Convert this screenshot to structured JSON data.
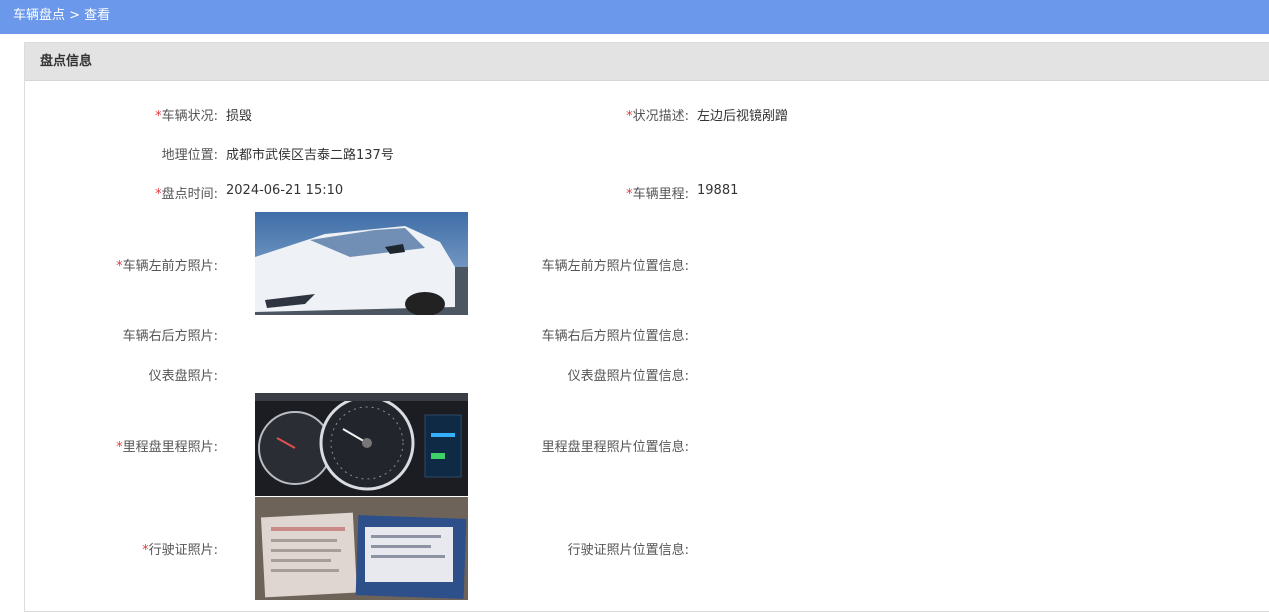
{
  "header": {
    "breadcrumb": "车辆盘点 > 查看"
  },
  "panel": {
    "title": "盘点信息"
  },
  "fields": {
    "status_label": "车辆状况:",
    "status_value": "损毁",
    "desc_label": "状况描述:",
    "desc_value": "左边后视镜剐蹭",
    "location_label": "地理位置:",
    "location_value": "成都市武侯区吉泰二路137号",
    "time_label": "盘点时间:",
    "time_value": "2024-06-21 15:10",
    "mileage_label": "车辆里程:",
    "mileage_value": "19881",
    "front_left_photo_label": "车辆左前方照片:",
    "front_left_loc_label": "车辆左前方照片位置信息:",
    "rear_right_photo_label": "车辆右后方照片:",
    "rear_right_loc_label": "车辆右后方照片位置信息:",
    "dashboard_photo_label": "仪表盘照片:",
    "dashboard_loc_label": "仪表盘照片位置信息:",
    "odometer_photo_label": "里程盘里程照片:",
    "odometer_loc_label": "里程盘里程照片位置信息:",
    "license_photo_label": "行驶证照片:",
    "license_loc_label": "行驶证照片位置信息:"
  },
  "required_mark": "*",
  "colors": {
    "topbar": "#6b98ea",
    "required": "#e23b3b",
    "panel_header": "#e3e3e3"
  }
}
